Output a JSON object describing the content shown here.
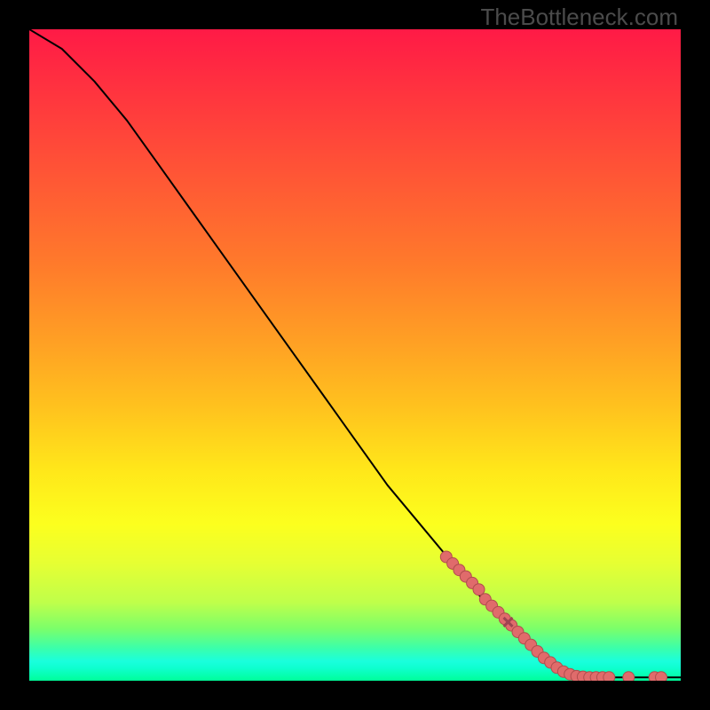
{
  "watermark": "TheBottleneck.com",
  "chart_data": {
    "type": "line",
    "title": "",
    "xlabel": "",
    "ylabel": "",
    "xlim": [
      0,
      100
    ],
    "ylim": [
      0,
      100
    ],
    "grid": false,
    "curve": [
      {
        "x": 0,
        "y": 100
      },
      {
        "x": 5,
        "y": 97
      },
      {
        "x": 10,
        "y": 92
      },
      {
        "x": 15,
        "y": 86
      },
      {
        "x": 20,
        "y": 79
      },
      {
        "x": 25,
        "y": 72
      },
      {
        "x": 30,
        "y": 65
      },
      {
        "x": 35,
        "y": 58
      },
      {
        "x": 40,
        "y": 51
      },
      {
        "x": 45,
        "y": 44
      },
      {
        "x": 50,
        "y": 37
      },
      {
        "x": 55,
        "y": 30
      },
      {
        "x": 60,
        "y": 24
      },
      {
        "x": 65,
        "y": 18
      },
      {
        "x": 70,
        "y": 12
      },
      {
        "x": 75,
        "y": 7
      },
      {
        "x": 80,
        "y": 3
      },
      {
        "x": 83,
        "y": 1
      },
      {
        "x": 86,
        "y": 0.5
      },
      {
        "x": 90,
        "y": 0.5
      },
      {
        "x": 95,
        "y": 0.5
      },
      {
        "x": 100,
        "y": 0.5
      }
    ],
    "highlighted_points": [
      {
        "x": 64,
        "y": 19
      },
      {
        "x": 65,
        "y": 18
      },
      {
        "x": 66,
        "y": 17
      },
      {
        "x": 67,
        "y": 16
      },
      {
        "x": 68,
        "y": 15
      },
      {
        "x": 69,
        "y": 14
      },
      {
        "x": 70,
        "y": 12.5
      },
      {
        "x": 71,
        "y": 11.5
      },
      {
        "x": 72,
        "y": 10.5
      },
      {
        "x": 73,
        "y": 9.5
      },
      {
        "x": 74,
        "y": 8.5
      },
      {
        "x": 75,
        "y": 7.5
      },
      {
        "x": 76,
        "y": 6.5
      },
      {
        "x": 77,
        "y": 5.5
      },
      {
        "x": 78,
        "y": 4.5
      },
      {
        "x": 79,
        "y": 3.5
      },
      {
        "x": 80,
        "y": 2.8
      },
      {
        "x": 81,
        "y": 2.0
      },
      {
        "x": 82,
        "y": 1.4
      },
      {
        "x": 83,
        "y": 1.0
      },
      {
        "x": 84,
        "y": 0.7
      },
      {
        "x": 85,
        "y": 0.6
      },
      {
        "x": 86,
        "y": 0.5
      },
      {
        "x": 87,
        "y": 0.5
      },
      {
        "x": 88,
        "y": 0.5
      },
      {
        "x": 89,
        "y": 0.5
      },
      {
        "x": 92,
        "y": 0.5
      },
      {
        "x": 96,
        "y": 0.5
      },
      {
        "x": 97,
        "y": 0.5
      }
    ],
    "cross_marker": {
      "x": 73.5,
      "y": 9.0
    }
  }
}
